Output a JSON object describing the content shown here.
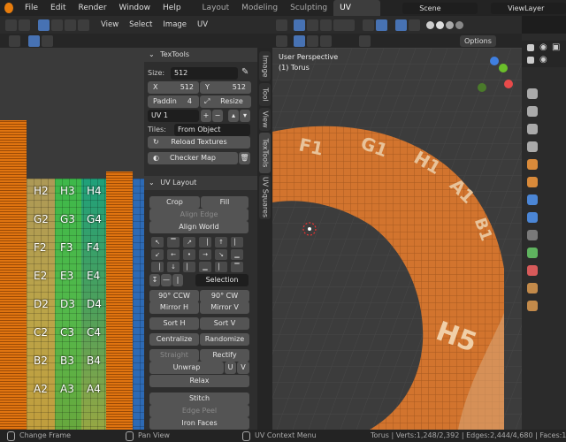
{
  "menubar": {
    "menus": [
      "File",
      "Edit",
      "Render",
      "Window",
      "Help"
    ],
    "workspaces": [
      "Layout",
      "Modeling",
      "Sculpting",
      "UV Editing"
    ],
    "active_workspace": "UV Editing",
    "scene": "Scene",
    "view_layer": "ViewLayer"
  },
  "uv_header": {
    "menus": [
      "View",
      "Select",
      "Image",
      "UV"
    ]
  },
  "viewport_header": {
    "options": "Options"
  },
  "uv_grid": {
    "rows": [
      [
        "H2",
        "H3",
        "H4"
      ],
      [
        "G2",
        "G3",
        "G4"
      ],
      [
        "F2",
        "F3",
        "F4"
      ],
      [
        "E2",
        "E3",
        "E4"
      ],
      [
        "D2",
        "D3",
        "D4"
      ],
      [
        "C2",
        "C3",
        "C4"
      ],
      [
        "B2",
        "B3",
        "B4"
      ],
      [
        "A2",
        "A3",
        "A4"
      ]
    ]
  },
  "textools": {
    "title": "TexTools",
    "size_label": "Size:",
    "size_value": "512",
    "x_label": "X",
    "x_value": "512",
    "y_label": "Y",
    "y_value": "512",
    "padding_label": "Paddin",
    "padding_value": "4",
    "resize": "Resize",
    "uv_map": "UV 1",
    "tiles_label": "Tiles:",
    "tiles_value": "From Object",
    "reload": "Reload Textures",
    "checker": "Checker Map"
  },
  "uv_layout": {
    "title": "UV Layout",
    "crop": "Crop",
    "fill": "Fill",
    "align_edge": "Align Edge",
    "align_world": "Align World",
    "selection": "Selection",
    "ccw": "90° CCW",
    "cw": "90° CW",
    "mirror_h": "Mirror H",
    "mirror_v": "Mirror V",
    "sort_h": "Sort H",
    "sort_v": "Sort V",
    "centralize": "Centralize",
    "randomize": "Randomize",
    "straight": "Straight",
    "rectify": "Rectify",
    "unwrap": "Unwrap",
    "u": "U",
    "v": "V",
    "relax": "Relax",
    "stitch": "Stitch",
    "edge_peel": "Edge Peel",
    "iron_faces": "Iron Faces"
  },
  "side_tabs": [
    "Image",
    "Tool",
    "View",
    "TexTools",
    "UV Squares"
  ],
  "viewport": {
    "perspective": "User Perspective",
    "object": "(1) Torus",
    "ring_labels": [
      "F1",
      "G1",
      "H1",
      "A1",
      "B1",
      "H5"
    ]
  },
  "status_bar": {
    "change_frame": "Change Frame",
    "pan_view": "Pan View",
    "context_menu": "UV Context Menu",
    "stats": "Torus | Verts:1,248/2,392 | Edges:2,444/4,680 | Faces:1,196/2,"
  },
  "colors": {
    "accent": "#4772b3",
    "orange": "#e07410",
    "panel_bg": "#2e2e2e",
    "button": "#545454"
  }
}
